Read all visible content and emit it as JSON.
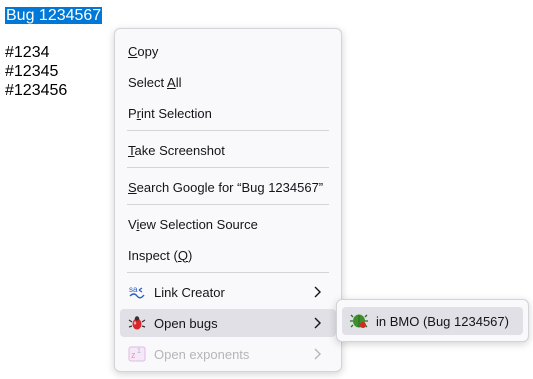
{
  "page": {
    "selected_text": "Bug 1234567",
    "lines": [
      "#1234",
      "#12345",
      "#123456"
    ]
  },
  "menu": {
    "copy": {
      "pre": "",
      "key": "C",
      "post": "opy"
    },
    "select_all": {
      "pre": "Select ",
      "key": "A",
      "post": "ll"
    },
    "print_selection": {
      "pre": "P",
      "key": "r",
      "post": "int Selection"
    },
    "take_screenshot": {
      "pre": "",
      "key": "T",
      "post": "ake Screenshot"
    },
    "search_google": {
      "pre": "",
      "key": "S",
      "post": "earch Google for “Bug 1234567”"
    },
    "view_source": {
      "pre": "V",
      "key": "i",
      "post": "ew Selection Source"
    },
    "inspect": {
      "pre": "Inspect (",
      "key": "Q",
      "post": ")"
    },
    "link_creator": "Link Creator",
    "open_bugs": "Open bugs",
    "open_exponents": "Open exponents"
  },
  "submenu": {
    "in_bmo": "in BMO (Bug 1234567)"
  },
  "icons": {
    "link_creator": "link-creator-icon",
    "open_bugs": "bug-icon",
    "open_exponents": "exponent-icon",
    "in_bmo": "bmo-bug-icon",
    "submenu_arrow": "chevron-right-icon"
  },
  "colors": {
    "selection": "#0078d7",
    "menu_bg": "#f9f9fb",
    "hover_bg": "#e0e0e6",
    "disabled_text": "#b5b5ba"
  }
}
